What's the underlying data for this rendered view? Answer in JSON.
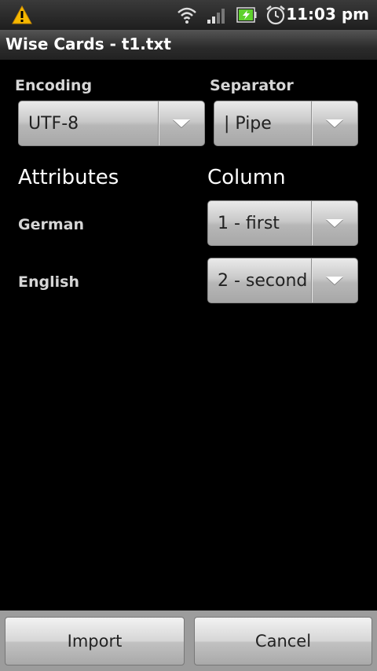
{
  "statusbar": {
    "time": "11:03 pm",
    "icons": [
      "warning-icon",
      "wifi-icon",
      "signal-icon",
      "battery-icon",
      "alarm-icon"
    ]
  },
  "titlebar": {
    "title": "Wise Cards - t1.txt"
  },
  "encoding": {
    "label": "Encoding",
    "value": "UTF-8"
  },
  "separator": {
    "label": "Separator",
    "value": "| Pipe"
  },
  "attributes": {
    "header": "Attributes",
    "column_header": "Column",
    "rows": [
      {
        "name": "German",
        "column": "1 - first"
      },
      {
        "name": "English",
        "column": "2 - second"
      }
    ]
  },
  "buttons": {
    "import": "Import",
    "cancel": "Cancel"
  },
  "colors": {
    "background": "#000000",
    "spinner_text": "#222222",
    "warning": "#f5b800",
    "battery": "#5fd12d"
  }
}
